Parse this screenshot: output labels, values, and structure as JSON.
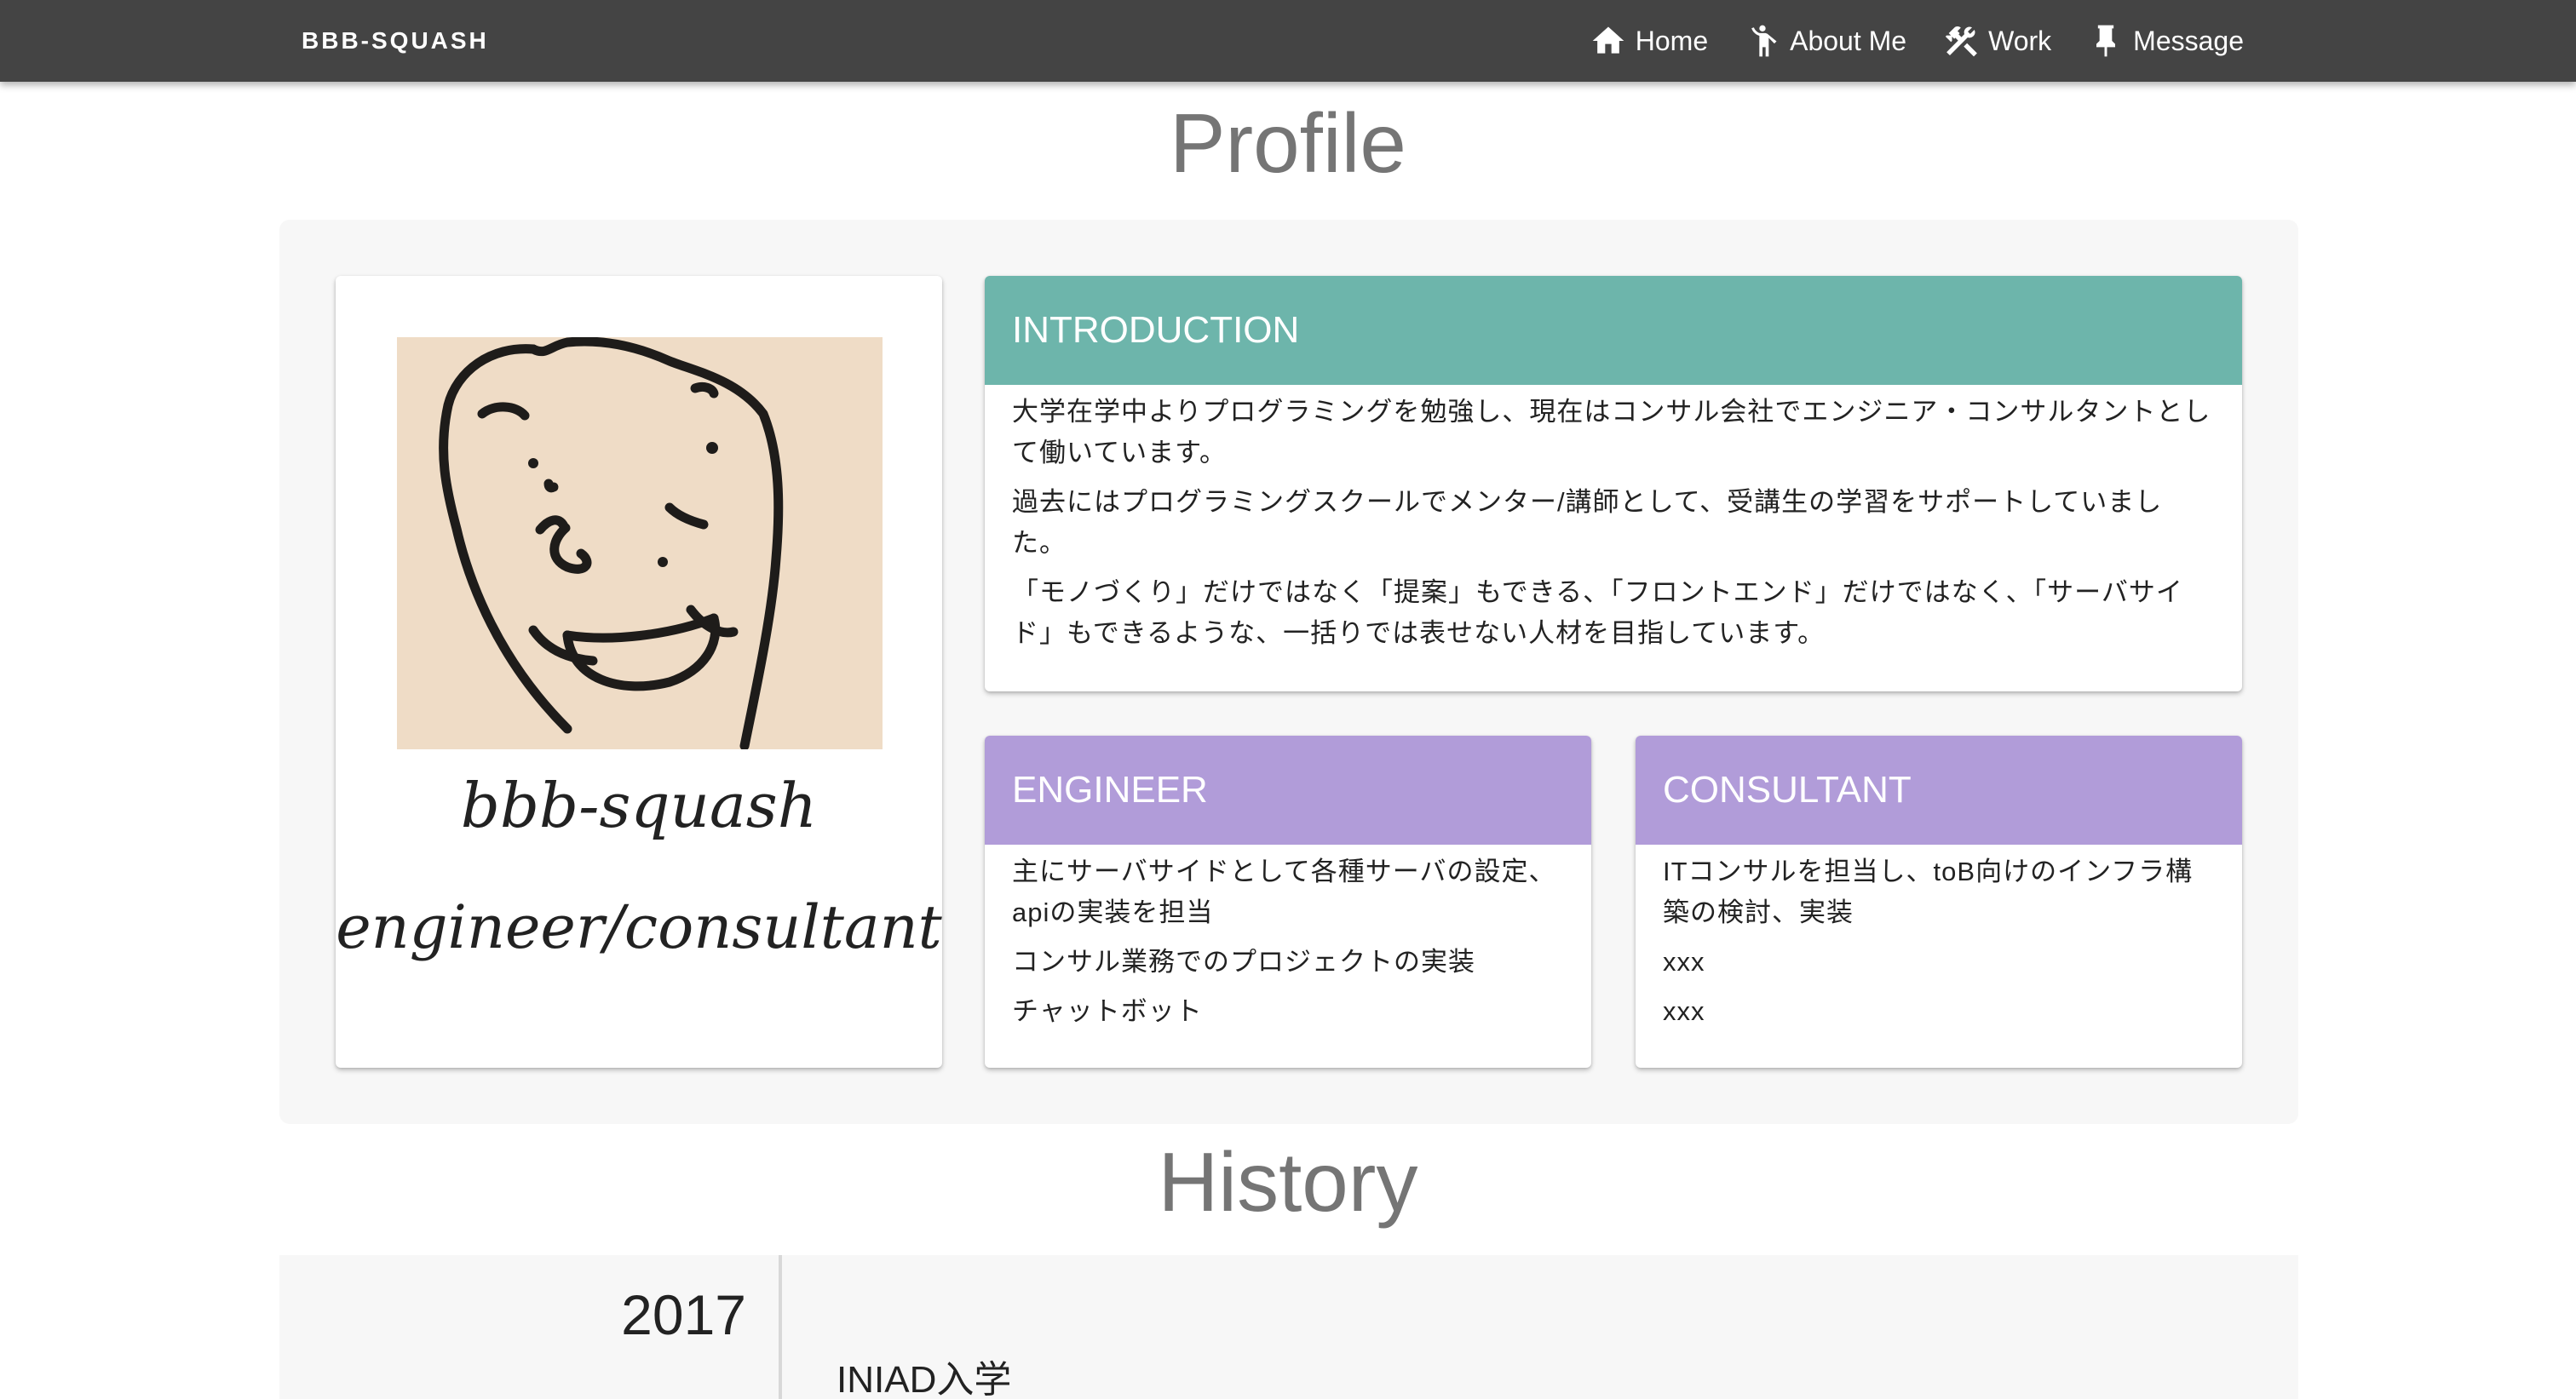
{
  "navbar": {
    "brand": "BBB-SQUASH",
    "items": [
      {
        "label": "Home",
        "icon": "home-icon"
      },
      {
        "label": "About Me",
        "icon": "person-icon"
      },
      {
        "label": "Work",
        "icon": "tools-icon"
      },
      {
        "label": "Message",
        "icon": "pin-icon"
      }
    ]
  },
  "profile": {
    "title": "Profile",
    "name": "bbb-squash",
    "role": "engineer/consultant",
    "introduction": {
      "heading": "INTRODUCTION",
      "paragraphs": [
        "大学在学中よりプログラミングを勉強し、現在はコンサル会社でエンジニア・コンサルタントとして働いています。",
        "過去にはプログラミングスクールでメンター/講師として、受講生の学習をサポートしていました。",
        "「モノづくり」だけではなく「提案」もできる、「フロントエンド」だけではなく、「サーバサイド」もできるような、一括りでは表せない人材を目指しています。"
      ]
    },
    "engineer": {
      "heading": "ENGINEER",
      "items": [
        "主にサーバサイドとして各種サーバの設定、apiの実装を担当",
        "コンサル業務でのプロジェクトの実装",
        "チャットボット"
      ]
    },
    "consultant": {
      "heading": "CONSULTANT",
      "items": [
        "ITコンサルを担当し、toB向けのインフラ構築の検討、実装",
        "xxx",
        "xxx"
      ]
    }
  },
  "history": {
    "title": "History",
    "entries": [
      {
        "year": "2017",
        "text": "INIAD入学"
      }
    ]
  },
  "colors": {
    "navbar": "#444444",
    "teal": "#6db5ab",
    "purple": "#b19cd9",
    "title_gray": "#757575"
  }
}
